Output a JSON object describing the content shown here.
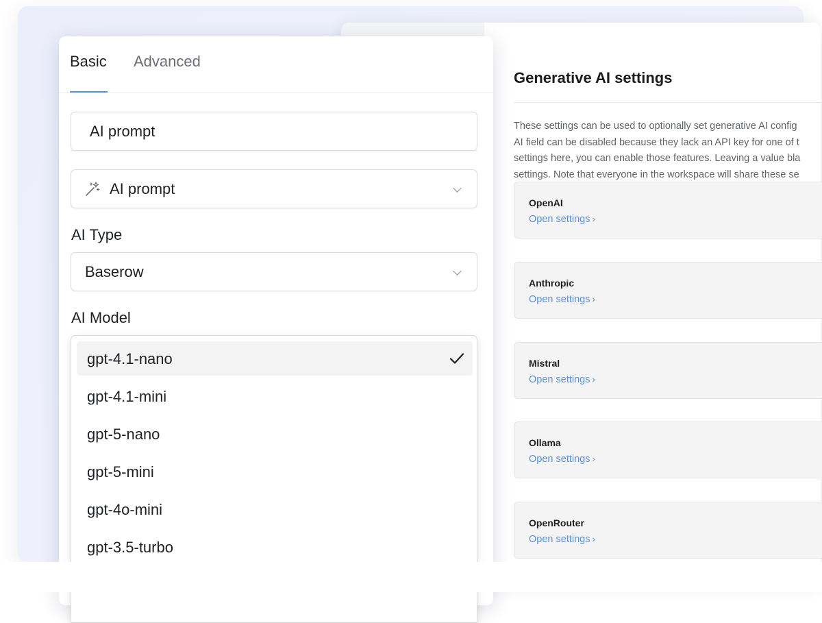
{
  "settings": {
    "title": "Generative AI settings",
    "description_lines": [
      "These settings can be used to optionally set generative AI config",
      "AI field can be disabled because they lack an API key for one of t",
      "settings here, you can enable those features. Leaving a value bla",
      "settings. Note that everyone in the workspace will share these se"
    ],
    "providers": [
      {
        "name": "OpenAI",
        "link": "Open settings"
      },
      {
        "name": "Anthropic",
        "link": "Open settings"
      },
      {
        "name": "Mistral",
        "link": "Open settings"
      },
      {
        "name": "Ollama",
        "link": "Open settings"
      },
      {
        "name": "OpenRouter",
        "link": "Open settings"
      }
    ],
    "link_chevron": "›"
  },
  "form": {
    "tabs": [
      {
        "label": "Basic",
        "active": true
      },
      {
        "label": "Advanced",
        "active": false
      }
    ],
    "name_input_value": "AI prompt",
    "field_type": {
      "label": "AI prompt",
      "icon": "magic-wand-icon"
    },
    "ai_type": {
      "label": "AI Type",
      "value": "Baserow"
    },
    "ai_model": {
      "label": "AI Model",
      "options": [
        "gpt-4.1-nano",
        "gpt-4.1-mini",
        "gpt-5-nano",
        "gpt-5-mini",
        "gpt-4o-mini",
        "gpt-3.5-turbo"
      ],
      "selected": "gpt-4.1-nano"
    }
  },
  "colors": {
    "accent": "#5b8fd9",
    "background": "#eceefb"
  }
}
